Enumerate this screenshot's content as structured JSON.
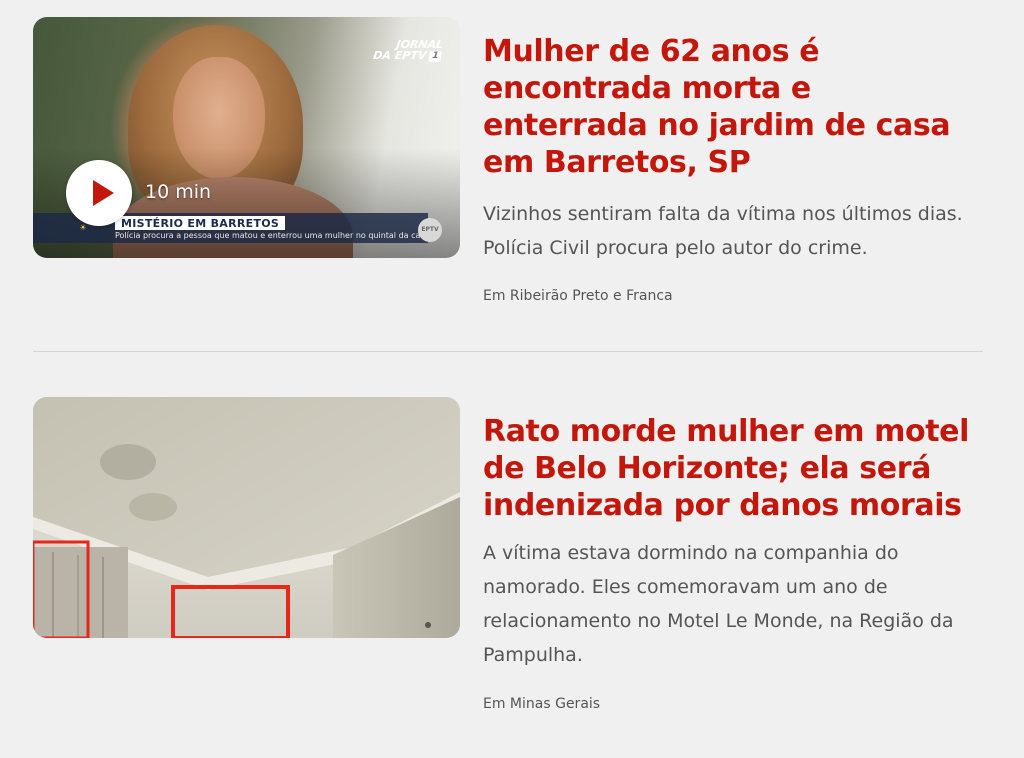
{
  "articles": [
    {
      "headline": "Mulher de 62 anos é encontrada morta e enterrada no jardim de casa em Barretos, SP",
      "summary": "Vizinhos sentiram falta da vítima nos últimos dias. Polícia Civil procura pelo autor do crime.",
      "meta": "Em Ribeirão Preto e Franca",
      "thumbnail": {
        "type": "video",
        "duration": "10 min",
        "overlay_title": "MISTÉRIO EM BARRETOS",
        "overlay_subtitle": "Polícia procura a pessoa que matou e enterrou uma mulher no quintal da casa dela",
        "watermark_line1": "JORNAL",
        "watermark_line2": "DA EPTV",
        "channel_logo": "EPTV",
        "play_icon": "play-icon"
      }
    },
    {
      "headline": "Rato morde mulher em motel de Belo Horizonte; ela será indenizada por danos morais",
      "summary": "A vítima estava dormindo na companhia do namorado. Eles comemoravam um ano de relacionamento no Motel Le Monde, na Região da Pampulha.",
      "meta": "Em Minas Gerais",
      "thumbnail": {
        "type": "image"
      }
    }
  ],
  "colors": {
    "headline": "#c4170c",
    "text": "#555555",
    "background": "#f0f0f0",
    "divider": "#d4d4d4"
  }
}
